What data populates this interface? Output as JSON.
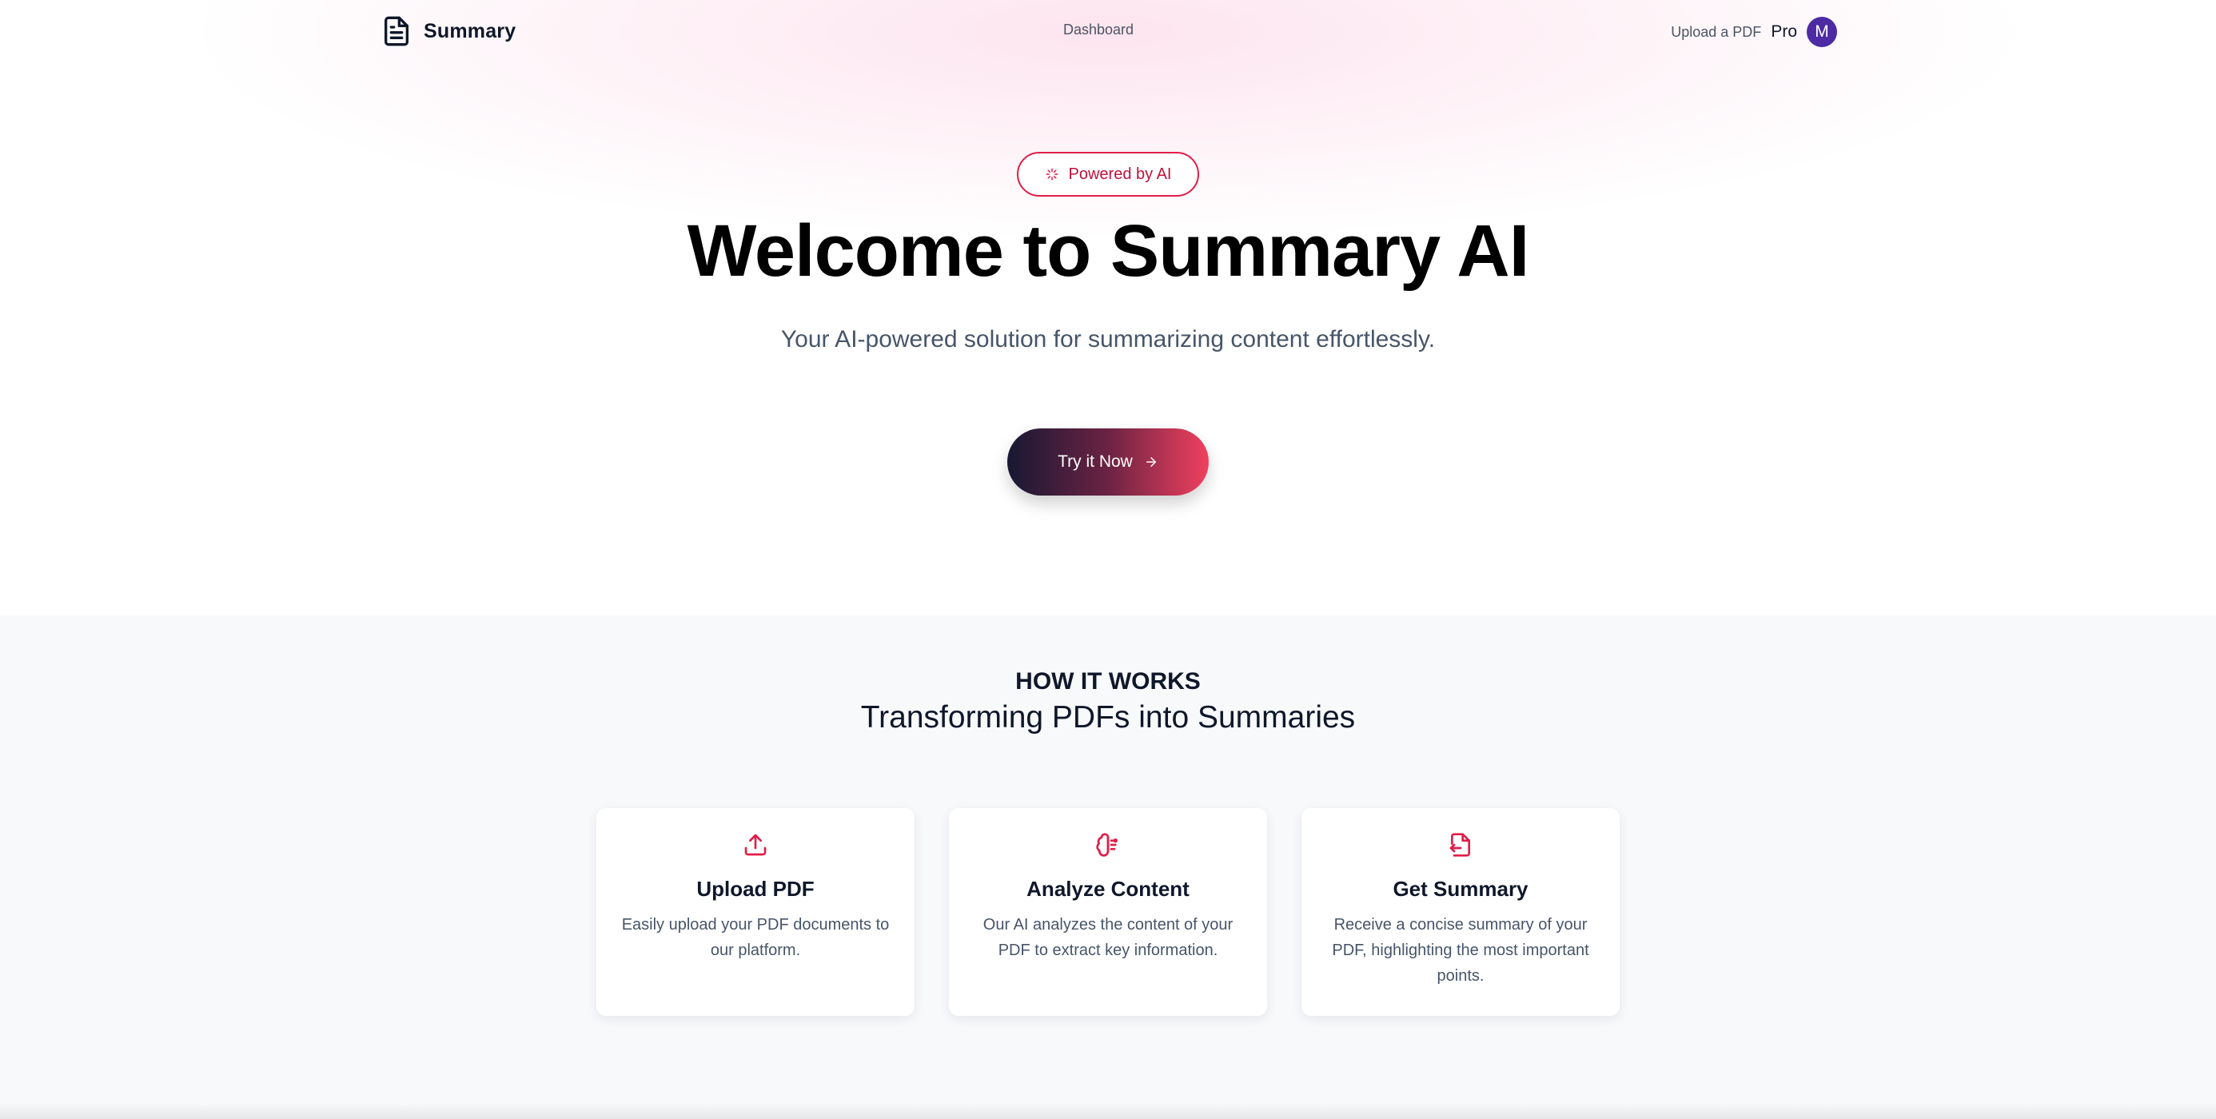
{
  "header": {
    "brand": "Summary",
    "brand_icon": "document-icon",
    "nav": {
      "dashboard": "Dashboard"
    },
    "upload_link": "Upload a PDF",
    "plan_badge": "Pro",
    "avatar_initial": "M",
    "avatar_color": "#4c2ba5"
  },
  "hero": {
    "badge_icon": "sparkles-icon",
    "badge": "Powered by AI",
    "title": "Welcome to Summary AI",
    "subtitle": "Your AI-powered solution for summarizing content effortlessly.",
    "cta": "Try it Now",
    "cta_icon": "arrow-right-icon"
  },
  "how_it_works": {
    "eyebrow": "HOW IT WORKS",
    "title": "Transforming PDFs into Summaries",
    "steps": [
      {
        "icon": "upload-icon",
        "title": "Upload PDF",
        "description": "Easily upload your PDF documents to our platform."
      },
      {
        "icon": "brain-icon",
        "title": "Analyze Content",
        "description": "Our AI analyzes the content of your PDF to extract key information."
      },
      {
        "icon": "file-output-icon",
        "title": "Get Summary",
        "description": "Receive a concise summary of your PDF, highlighting the most important points."
      }
    ]
  },
  "colors": {
    "accent": "#e11d48",
    "cta_gradient_start": "#181833",
    "cta_gradient_end": "#f0405e",
    "section_background": "#f8f9fb"
  }
}
